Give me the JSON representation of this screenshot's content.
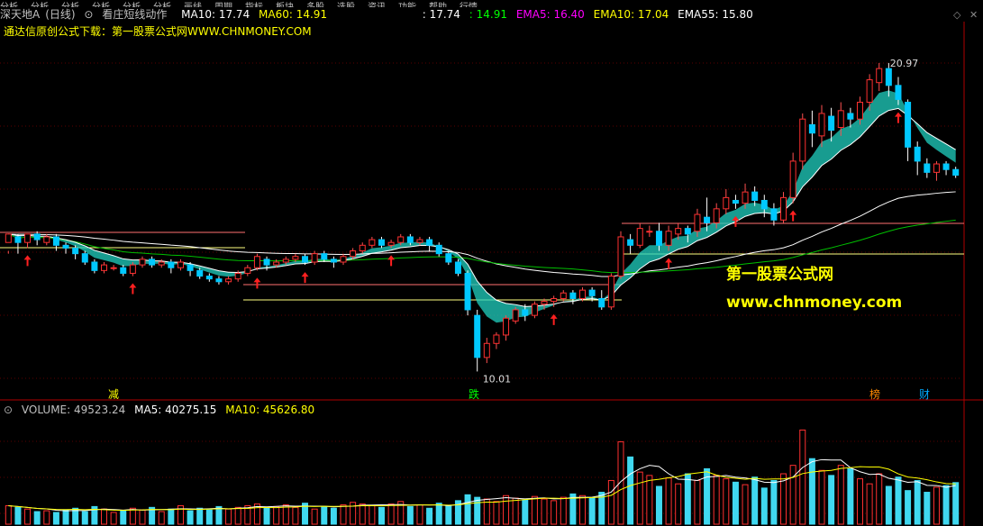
{
  "topbar": {
    "items": [
      "分析",
      "分析",
      "分析",
      "分析",
      "分析",
      "分析",
      "画线",
      "周期",
      "指标",
      "板块",
      "多股",
      "选股",
      "资讯",
      "功能",
      "帮助",
      "行情"
    ]
  },
  "legend": {
    "stock_name": "深天地A",
    "period": "(日线)",
    "indicator": "看庄短线动作",
    "ma10": "MA10: 17.74",
    "ma60": "MA60: 14.91",
    "v1": ": 17.74",
    "v2": ": 14.91",
    "ema5": "EMA5: 16.40",
    "ema10": "EMA10: 17.04",
    "ema55": "EMA55: 15.80",
    "colors": {
      "ma10": "#ffffff",
      "ma60": "#ffff00",
      "ema5": "#ff00ff",
      "ema10": "#00ff00",
      "ema55": "#ffffff"
    }
  },
  "ad_text": "通达信原创公式下载：第一股票公式网WWW.CHNMONEY.COM",
  "price_labels": {
    "high": "20.97",
    "low": "10.01"
  },
  "markers": [
    "减",
    "跌",
    "榜",
    "财"
  ],
  "watermark": {
    "line1": "第一股票公式网",
    "line2": "www.chnmoney.com"
  },
  "volume_legend": {
    "volume": "VOLUME: 49523.24",
    "ma5": "MA5: 40275.15",
    "ma10": "MA10: 45626.80"
  },
  "corner_icons": [
    "diamond-icon",
    "close-icon"
  ],
  "chart_data": {
    "type": "candlestick",
    "y_range": [
      9.5,
      21.8
    ],
    "candles": [
      [
        14.6,
        14.9,
        14.3,
        14.2
      ],
      [
        14.8,
        14.6,
        14.2,
        14.9
      ],
      [
        14.6,
        14.9,
        14.4,
        14.8
      ],
      [
        14.9,
        14.7,
        14.5,
        15.0
      ],
      [
        14.6,
        14.8,
        14.5,
        14.9
      ],
      [
        14.8,
        14.5,
        14.3,
        14.9
      ],
      [
        14.5,
        14.4,
        14.2,
        14.6
      ],
      [
        14.4,
        14.2,
        14.0,
        14.5
      ],
      [
        14.2,
        13.9,
        13.8,
        14.3
      ],
      [
        13.9,
        13.6,
        13.5,
        14.0
      ],
      [
        13.6,
        13.8,
        13.5,
        13.9
      ],
      [
        13.7,
        13.7,
        13.6,
        13.8
      ],
      [
        13.7,
        13.5,
        13.4,
        13.8
      ],
      [
        13.5,
        13.8,
        13.4,
        13.9
      ],
      [
        13.8,
        14.0,
        13.7,
        14.1
      ],
      [
        14.0,
        13.8,
        13.7,
        14.1
      ],
      [
        13.8,
        13.9,
        13.7,
        14.0
      ],
      [
        13.9,
        13.7,
        13.5,
        14.0
      ],
      [
        13.7,
        13.9,
        13.6,
        14.0
      ],
      [
        13.8,
        13.6,
        13.4,
        13.9
      ],
      [
        13.6,
        13.4,
        13.3,
        13.7
      ],
      [
        13.4,
        13.3,
        13.2,
        13.5
      ],
      [
        13.3,
        13.2,
        13.1,
        13.4
      ],
      [
        13.2,
        13.3,
        13.1,
        13.4
      ],
      [
        13.3,
        13.5,
        13.2,
        13.6
      ],
      [
        13.5,
        13.7,
        13.4,
        13.8
      ],
      [
        13.7,
        14.1,
        13.6,
        14.2
      ],
      [
        14.0,
        13.8,
        13.6,
        14.1
      ],
      [
        13.8,
        13.9,
        13.7,
        14.0
      ],
      [
        13.9,
        14.0,
        13.8,
        14.1
      ],
      [
        14.0,
        14.1,
        13.9,
        14.2
      ],
      [
        14.1,
        13.9,
        13.8,
        14.2
      ],
      [
        13.9,
        14.2,
        13.8,
        14.3
      ],
      [
        14.2,
        14.0,
        13.9,
        14.3
      ],
      [
        14.0,
        13.9,
        13.7,
        14.1
      ],
      [
        13.9,
        14.1,
        13.8,
        14.2
      ],
      [
        14.1,
        14.3,
        14.0,
        14.4
      ],
      [
        14.3,
        14.5,
        14.2,
        14.6
      ],
      [
        14.5,
        14.7,
        14.4,
        14.8
      ],
      [
        14.7,
        14.5,
        14.4,
        14.8
      ],
      [
        14.5,
        14.6,
        14.4,
        14.7
      ],
      [
        14.6,
        14.8,
        14.5,
        14.9
      ],
      [
        14.8,
        14.6,
        14.5,
        14.9
      ],
      [
        14.6,
        14.7,
        14.5,
        14.8
      ],
      [
        14.7,
        14.5,
        14.3,
        14.8
      ],
      [
        14.5,
        14.2,
        14.1,
        14.6
      ],
      [
        14.2,
        13.9,
        13.8,
        14.3
      ],
      [
        13.9,
        13.5,
        13.4,
        14.0
      ],
      [
        13.5,
        12.2,
        12.0,
        13.6
      ],
      [
        12.0,
        10.5,
        10.0,
        12.2
      ],
      [
        10.5,
        11.0,
        10.3,
        11.2
      ],
      [
        11.0,
        11.3,
        10.8,
        11.4
      ],
      [
        11.3,
        11.9,
        11.1,
        12.0
      ],
      [
        11.8,
        12.2,
        11.7,
        12.3
      ],
      [
        12.2,
        12.0,
        11.8,
        12.4
      ],
      [
        12.0,
        12.4,
        11.9,
        12.5
      ],
      [
        12.4,
        12.5,
        12.2,
        12.6
      ],
      [
        12.5,
        12.6,
        12.3,
        12.7
      ],
      [
        12.6,
        12.8,
        12.5,
        12.9
      ],
      [
        12.8,
        12.6,
        12.4,
        12.9
      ],
      [
        12.6,
        12.9,
        12.5,
        13.0
      ],
      [
        12.9,
        12.7,
        12.5,
        13.0
      ],
      [
        12.6,
        12.3,
        12.2,
        12.9
      ],
      [
        12.3,
        13.4,
        12.2,
        13.5
      ],
      [
        13.4,
        14.8,
        13.3,
        15.0
      ],
      [
        14.7,
        14.5,
        14.2,
        14.9
      ],
      [
        14.5,
        15.1,
        14.4,
        15.3
      ],
      [
        15.0,
        15.0,
        14.8,
        15.2
      ],
      [
        15.0,
        14.5,
        14.3,
        15.3
      ],
      [
        14.5,
        15.0,
        14.3,
        15.2
      ],
      [
        14.9,
        15.1,
        14.7,
        15.3
      ],
      [
        15.1,
        14.9,
        14.6,
        15.2
      ],
      [
        15.0,
        15.6,
        14.8,
        15.8
      ],
      [
        15.5,
        15.3,
        15.0,
        16.2
      ],
      [
        15.3,
        15.8,
        15.1,
        16.0
      ],
      [
        15.8,
        16.2,
        15.6,
        16.5
      ],
      [
        16.1,
        16.0,
        15.8,
        16.3
      ],
      [
        16.0,
        16.4,
        15.8,
        16.7
      ],
      [
        16.4,
        16.1,
        15.9,
        16.6
      ],
      [
        16.1,
        15.8,
        15.5,
        16.3
      ],
      [
        15.8,
        15.4,
        15.2,
        16.0
      ],
      [
        15.4,
        16.2,
        15.3,
        16.4
      ],
      [
        16.2,
        17.5,
        16.0,
        17.8
      ],
      [
        17.5,
        19.0,
        17.2,
        19.2
      ],
      [
        18.8,
        18.5,
        18.0,
        19.3
      ],
      [
        18.4,
        19.2,
        18.0,
        19.5
      ],
      [
        19.1,
        18.6,
        18.2,
        19.4
      ],
      [
        18.7,
        19.3,
        18.4,
        19.6
      ],
      [
        19.2,
        19.0,
        18.7,
        19.4
      ],
      [
        19.0,
        19.6,
        18.8,
        19.8
      ],
      [
        19.6,
        20.4,
        19.3,
        20.6
      ],
      [
        20.3,
        20.8,
        20.0,
        21.0
      ],
      [
        20.8,
        20.2,
        19.8,
        21.0
      ],
      [
        20.2,
        19.7,
        19.5,
        20.5
      ],
      [
        19.6,
        18.0,
        17.5,
        19.7
      ],
      [
        18.0,
        17.5,
        17.0,
        18.2
      ],
      [
        17.4,
        17.1,
        16.9,
        17.6
      ],
      [
        17.1,
        17.4,
        16.8,
        17.5
      ],
      [
        17.4,
        17.2,
        17.0,
        17.5
      ],
      [
        17.2,
        17.0,
        16.9,
        17.3
      ]
    ],
    "volume_y_range": [
      0,
      120000
    ],
    "volumes": [
      22000,
      20000,
      18000,
      15000,
      16000,
      14000,
      17000,
      19000,
      15000,
      21000,
      18000,
      14000,
      16000,
      19000,
      17000,
      20000,
      15000,
      18000,
      22000,
      16000,
      19000,
      17000,
      21000,
      18000,
      20000,
      22000,
      24000,
      19000,
      21000,
      23000,
      20000,
      25000,
      18000,
      21000,
      19000,
      23000,
      26000,
      24000,
      22000,
      20000,
      24000,
      27000,
      21000,
      23000,
      19000,
      25000,
      22000,
      28000,
      35000,
      32000,
      30000,
      27000,
      34000,
      31000,
      29000,
      33000,
      30000,
      28000,
      32000,
      36000,
      34000,
      31000,
      38000,
      52000,
      98000,
      80000,
      62000,
      58000,
      45000,
      55000,
      48000,
      60000,
      52000,
      66000,
      58000,
      54000,
      50000,
      47000,
      56000,
      43000,
      52000,
      60000,
      70000,
      112000,
      78000,
      64000,
      58000,
      70000,
      66000,
      54000,
      48000,
      60000,
      45000,
      56000,
      40000,
      52000,
      38000,
      44000,
      46000,
      49523
    ]
  }
}
